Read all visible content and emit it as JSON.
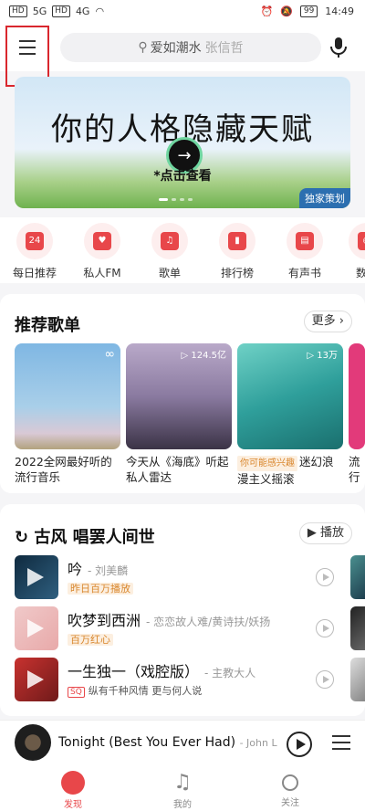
{
  "status_bar": {
    "sim1": "HD",
    "sim2": "HD",
    "net1": "5G",
    "net2": "4G",
    "battery": "99",
    "time": "14:49"
  },
  "header": {
    "search_keyword": "爱如潮水",
    "search_artist": "张信哲"
  },
  "banner": {
    "title": "你的人格隐藏天赋",
    "cta": "*点击查看",
    "tag": "独家策划"
  },
  "shortcuts": [
    {
      "label": "每日推荐",
      "icon": "calendar-icon",
      "glyph": "24"
    },
    {
      "label": "私人FM",
      "icon": "radio-icon",
      "glyph": ""
    },
    {
      "label": "歌单",
      "icon": "playlist-icon",
      "glyph": ""
    },
    {
      "label": "排行榜",
      "icon": "chart-icon",
      "glyph": ""
    },
    {
      "label": "有声书",
      "icon": "audiobook-icon",
      "glyph": ""
    },
    {
      "label": "数字",
      "icon": "digital-album-icon",
      "glyph": ""
    }
  ],
  "recommended": {
    "title": "推荐歌单",
    "more": "更多",
    "playlists": [
      {
        "title": "2022全网最好听的流行音乐",
        "count": "",
        "badge": ""
      },
      {
        "title": "今天从《海底》听起私人雷达",
        "count": "124.5亿",
        "badge": ""
      },
      {
        "title": "迷幻浪漫主义摇滚",
        "count": "13万",
        "badge": "你可能感兴趣"
      },
      {
        "title": "流行",
        "count": "",
        "badge": ""
      }
    ]
  },
  "song_section": {
    "title": "古风 唱罢人间世",
    "play_label": "播放",
    "songs": [
      {
        "name": "吟",
        "artist": "- 刘美麟",
        "tag": "昨日百万播放",
        "desc": ""
      },
      {
        "name": "吹梦到西洲",
        "artist": "- 恋恋故人难/黄诗扶/妖扬",
        "tag": "百万红心",
        "desc": ""
      },
      {
        "name": "一生独一（戏腔版）",
        "artist": "- 主教大人",
        "tag": "SQ",
        "desc": "纵有千种风情 更与何人说"
      }
    ]
  },
  "mini_player": {
    "title": "Tonight (Best You Ever Had)",
    "artist": "- John Le..."
  },
  "bottom_nav": [
    {
      "label": "发现",
      "icon": "netease-logo-icon",
      "active": true
    },
    {
      "label": "我的",
      "icon": "music-note-icon",
      "active": false
    },
    {
      "label": "关注",
      "icon": "person-icon",
      "active": false
    }
  ],
  "colors": {
    "accent": "#e8474a",
    "highlight_box": "#d9272e"
  }
}
